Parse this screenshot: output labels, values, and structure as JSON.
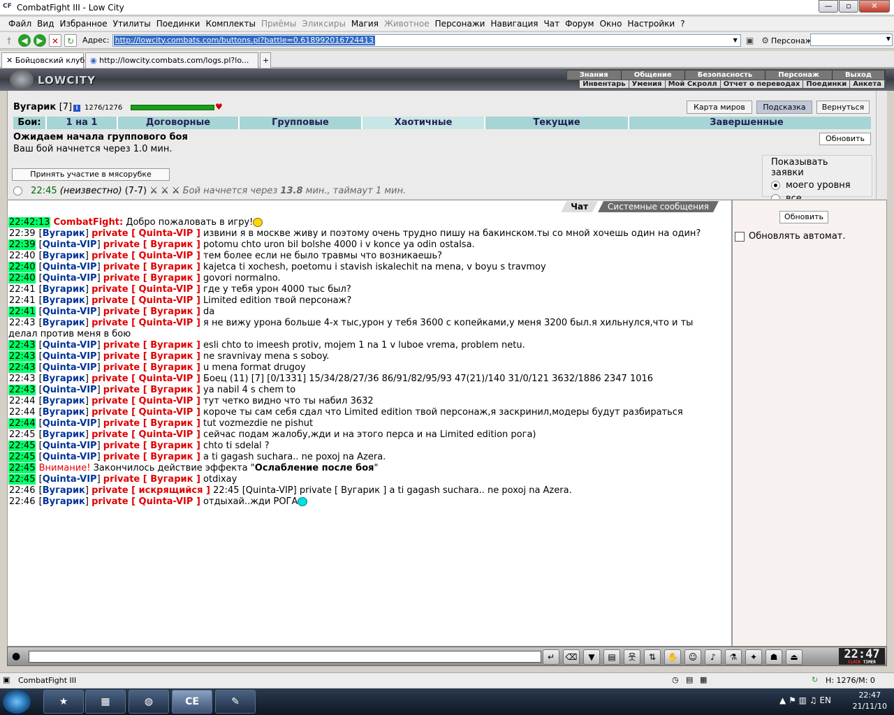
{
  "window": {
    "title": "CombatFight III - Low City"
  },
  "menu": [
    "Файл",
    "Вид",
    "Избранное",
    "Утилиты",
    "Поединки",
    "Комплекты",
    "Приёмы",
    "Эликсиры",
    "Магия",
    "Животное",
    "Персонажи",
    "Навигация",
    "Чат",
    "Форум",
    "Окно",
    "Настройки",
    "?"
  ],
  "menu_disabled": [
    "Приёмы",
    "Эликсиры",
    "Животное"
  ],
  "address": {
    "label": "Адрес:",
    "url": "http://lowcity.combats.com/buttons.pl?battle=0.618992016724413",
    "person_label": "Персонаж:"
  },
  "tabs": [
    "Бойцовский клуб",
    "http://lowcity.combats.com/logs.pl?lo..."
  ],
  "game": {
    "logo": "LOWCITY",
    "top_links": [
      "Знания",
      "Общение",
      "Безопасность",
      "Персонаж",
      "Выход"
    ],
    "sub_links": [
      "Инвентарь",
      "Умения",
      "Мой Скролл",
      "Отчет о переводах",
      "Поединки",
      "Анкета"
    ]
  },
  "battle": {
    "player_name": "Вугарик",
    "player_level": "[7]",
    "hp": "1276/1276",
    "buttons": {
      "map": "Карта миров",
      "hint": "Подсказка",
      "back": "Вернуться"
    },
    "tab_label": "Бои:",
    "tabs": [
      "1 на 1",
      "Договорные",
      "Групповые",
      "Хаотичные",
      "Текущие",
      "Завершенные"
    ],
    "wait_title": "Ожидаем начала группового боя",
    "wait_text": "Ваш бой начнется через 1.0 мин.",
    "refresh": "Обновить",
    "join": "Принять участие в мясорубке",
    "show_requests": "Показывать заявки",
    "req_options": [
      "моего уровня",
      "все"
    ],
    "application": {
      "time": "22:45",
      "who": "(неизвестно)",
      "count": "(7-7)",
      "status": "Бой начнется через",
      "minutes": "13.8",
      "rest": "мин., таймаут 1 мин."
    }
  },
  "chat_tabs": [
    "Чат",
    "Системные сообщения"
  ],
  "chat": [
    {
      "t": "22:42:13",
      "g": true,
      "kind": "sys",
      "sender": "CombatFight:",
      "text": "Добро пожаловать в игру!",
      "smile": "y"
    },
    {
      "t": "22:39",
      "g": false,
      "from": "Вугарик",
      "to": "Quinta-VIP",
      "text": "извини я в москве живу и поэтому очень трудно пишу на бакинском.ты со мной хочешь один на один?"
    },
    {
      "t": "22:39",
      "g": true,
      "from": "Quinta-VIP",
      "to": "Вугарик",
      "text": "potomu chto uron bil bolshe 4000 i v konce ya odin ostalsa."
    },
    {
      "t": "22:40",
      "g": false,
      "from": "Вугарик",
      "to": "Quinta-VIP",
      "text": "тем более если не было травмы что возникаешь?"
    },
    {
      "t": "22:40",
      "g": true,
      "from": "Quinta-VIP",
      "to": "Вугарик",
      "text": "kajetca ti xochesh, poetomu i stavish iskalechit na mena, v boyu s travmoy"
    },
    {
      "t": "22:40",
      "g": true,
      "from": "Quinta-VIP",
      "to": "Вугарик",
      "text": "govori normalno."
    },
    {
      "t": "22:41",
      "g": false,
      "from": "Вугарик",
      "to": "Quinta-VIP",
      "text": "где у тебя урон 4000 тыс был?"
    },
    {
      "t": "22:41",
      "g": false,
      "from": "Вугарик",
      "to": "Quinta-VIP",
      "text": "Limited edition твой персонаж?"
    },
    {
      "t": "22:41",
      "g": true,
      "from": "Quinta-VIP",
      "to": "Вугарик",
      "text": "da"
    },
    {
      "t": "22:43",
      "g": false,
      "from": "Вугарик",
      "to": "Quinta-VIP",
      "text": "я не вижу урона больше 4-х тыс,урон у тебя 3600 с копейками,у меня 3200 был.я хильнулся,что и ты делал против меня в бою",
      "wrap": true
    },
    {
      "t": "22:43",
      "g": true,
      "from": "Quinta-VIP",
      "to": "Вугарик",
      "text": "esli chto to imeesh protiv, mojem 1 na 1 v luboe vrema, problem netu."
    },
    {
      "t": "22:43",
      "g": true,
      "from": "Quinta-VIP",
      "to": "Вугарик",
      "text": "ne sravnivay mena s soboy."
    },
    {
      "t": "22:43",
      "g": true,
      "from": "Quinta-VIP",
      "to": "Вугарик",
      "text": "u mena format drugoy"
    },
    {
      "t": "22:43",
      "g": false,
      "from": "Вугарик",
      "to": "Quinta-VIP",
      "kind": "stats",
      "text": "Боец (11) [7] [0/1331] 15/34/28/27/36 86/91/82/95/93 47(21)/140 31/0/121 3632/1886 2347 1016"
    },
    {
      "t": "22:43",
      "g": true,
      "from": "Quinta-VIP",
      "to": "Вугарик",
      "text": "ya nabil 4 s chem to"
    },
    {
      "t": "22:44",
      "g": false,
      "from": "Вугарик",
      "to": "Quinta-VIP",
      "text": "тут четко видно что ты набил 3632"
    },
    {
      "t": "22:44",
      "g": false,
      "from": "Вугарик",
      "to": "Quinta-VIP",
      "text": "короче ты сам себя сдал что Limited edition твой персонаж,я заскринил,модеры будут разбираться"
    },
    {
      "t": "22:44",
      "g": true,
      "from": "Quinta-VIP",
      "to": "Вугарик",
      "text": "tut vozmezdie ne pishut"
    },
    {
      "t": "22:45",
      "g": false,
      "from": "Вугарик",
      "to": "Quinta-VIP",
      "text": "сейчас подам жалобу,жди и на этого перса и на Limited edition рога)"
    },
    {
      "t": "22:45",
      "g": true,
      "from": "Quinta-VIP",
      "to": "Вугарик",
      "text": "chto ti sdelal ?"
    },
    {
      "t": "22:45",
      "g": true,
      "from": "Quinta-VIP",
      "to": "Вугарик",
      "text": "a ti gagash suchara.. ne poxoj na Azera."
    },
    {
      "t": "22:45",
      "g": true,
      "kind": "warn",
      "sender": "Внимание!",
      "text": "Закончилось действие эффекта",
      "effect": "Ослабление после боя"
    },
    {
      "t": "22:45",
      "g": true,
      "from": "Quinta-VIP",
      "to": "Вугарик",
      "text": "otdixay"
    },
    {
      "t": "22:46",
      "g": false,
      "from": "Вугарик",
      "to": "искрящийся",
      "kind": "quote",
      "text": "22:45 [Quinta-VIP] private [ Вугарик ] a ti gagash suchara.. ne poxoj na Azera."
    },
    {
      "t": "22:46",
      "g": false,
      "from": "Вугарик",
      "to": "Quinta-VIP",
      "text": "отдыхай..жди РОГА",
      "smile": "b"
    }
  ],
  "side": {
    "refresh": "Обновить",
    "auto": "Обновлять автомат."
  },
  "clock": {
    "time": "22:47",
    "label_clock": "CLOCK",
    "label_timer": "TIMER"
  },
  "status": {
    "title": "CombatFight III",
    "hm": "H: 1276/M: 0"
  },
  "taskbar": {
    "time": "22:47",
    "date": "21/11/10",
    "lang": "EN",
    "cf_label": "CE"
  }
}
